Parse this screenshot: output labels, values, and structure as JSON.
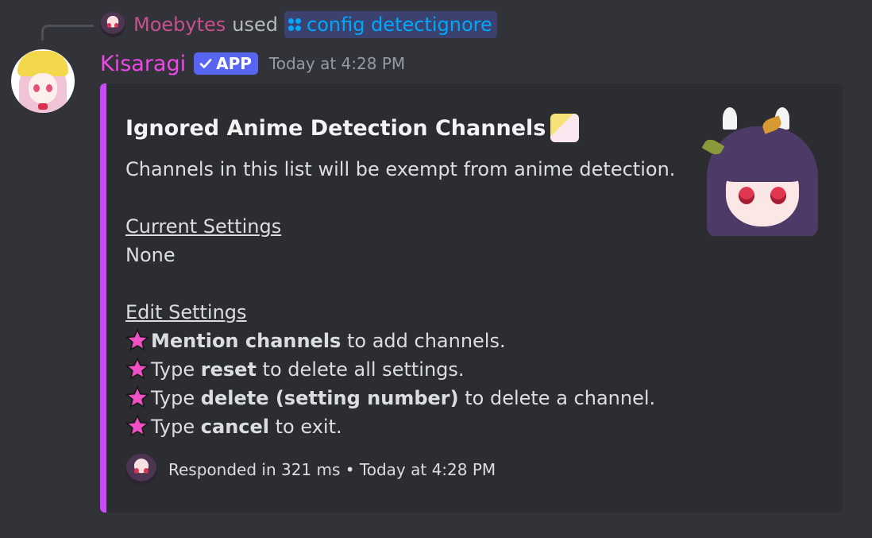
{
  "interaction": {
    "user": "Moebytes",
    "used_text": "used",
    "command": "config detectignore"
  },
  "message": {
    "author": "Kisaragi",
    "badge": "APP",
    "timestamp": "Today at 4:28 PM"
  },
  "embed": {
    "accent_color": "#c849f5",
    "title": "Ignored Anime Detection Channels",
    "description": "Channels in this list will be exempt from anime detection.",
    "current_settings_heading": "Current Settings",
    "current_settings_value": "None",
    "edit_settings_heading": "Edit Settings",
    "instructions": [
      {
        "bold": "Mention channels",
        "before": "",
        "after": " to add channels."
      },
      {
        "before": "Type ",
        "bold": "reset",
        "after": " to delete all settings."
      },
      {
        "before": "Type ",
        "bold": "delete (setting number)",
        "after": " to delete a channel."
      },
      {
        "before": "Type ",
        "bold": "cancel",
        "after": " to exit."
      }
    ],
    "footer_text": "Responded in 321 ms • Today at 4:28 PM"
  },
  "icons": {
    "command": "slash-command-icon",
    "badge_check": "checkmark-icon",
    "bullet": "pink-star-icon"
  }
}
